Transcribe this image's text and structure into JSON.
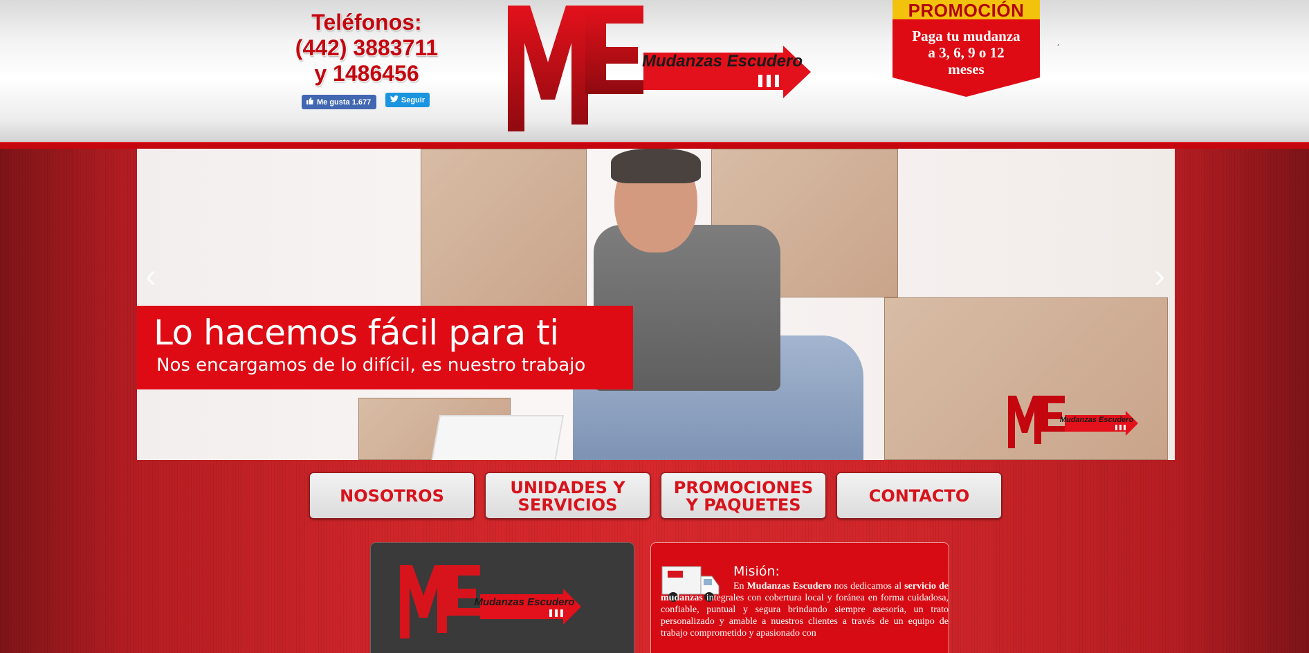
{
  "header": {
    "phones_title": "Teléfonos:",
    "phone_1": "(442) 3883711",
    "phone_2": "y 1486456",
    "facebook_label": "Me gusta 1.677",
    "twitter_label": "Seguir",
    "logo_letters": "ME",
    "logo_name": "Mudanzas Escudero",
    "promo_title": "PROMOCIÓN",
    "promo_line_1": "Paga tu mudanza",
    "promo_line_2": "a 3, 6, 9 o 12",
    "promo_line_3": "meses",
    "tick": "´"
  },
  "slider": {
    "title": "Lo hacemos fácil para ti",
    "subtitle": "Nos encargamos de lo difícil, es nuestro trabajo",
    "prev_icon": "‹",
    "next_icon": "›",
    "logo_letters": "ME",
    "logo_name": "Mudanzas Escudero"
  },
  "nav": [
    {
      "line1": "NOSOTROS",
      "line2": ""
    },
    {
      "line1": "UNIDADES Y",
      "line2": "SERVICIOS"
    },
    {
      "line1": "PROMOCIONES",
      "line2": "Y PAQUETES"
    },
    {
      "line1": "CONTACTO",
      "line2": ""
    }
  ],
  "content": {
    "logo_letters": "ME",
    "logo_name": "Mudanzas Escudero",
    "mission_title": "Misión:",
    "mission_text_1": "En ",
    "mission_brand": "Mudanzas Escudero",
    "mission_text_2": " nos dedicamos al ",
    "mission_service": "servicio de mudanzas",
    "mission_text_3": " integrales con cobertura local y foránea en forma cuidadosa, confiable, puntual y segura brindando siempre asesoría, un trato personalizado y amable a nuestros clientes a través de un equipo de trabajo comprometido y apasionado con"
  },
  "colors": {
    "brand_red": "#de0b14",
    "promo_yellow": "#f3c20d",
    "dark_panel": "#3a3a3a"
  }
}
